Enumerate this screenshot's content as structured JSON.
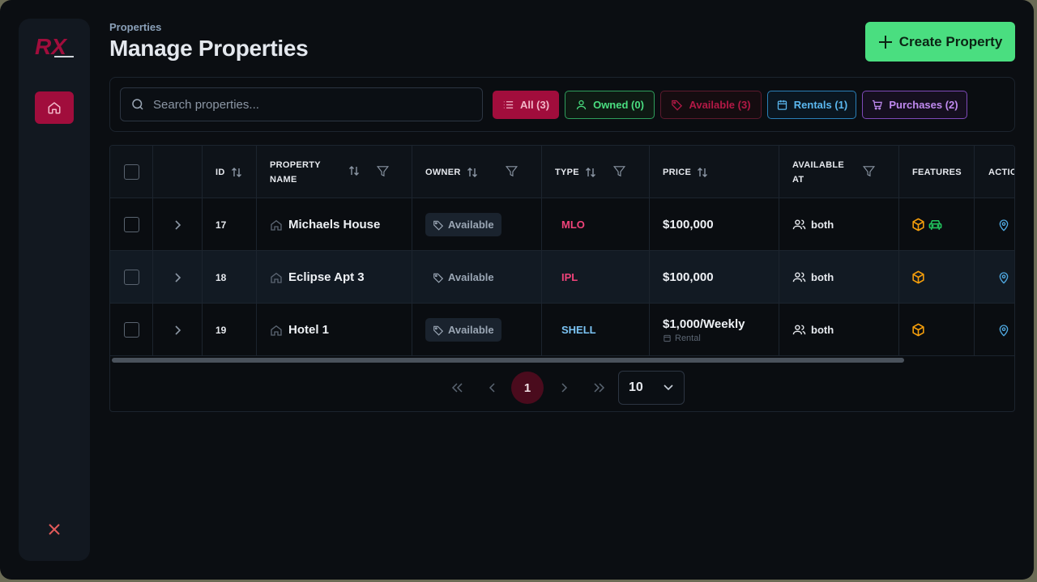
{
  "sidebar": {
    "logo_text": "RX",
    "items": [
      {
        "icon": "home-icon",
        "active": true
      }
    ],
    "close_icon": "close-icon"
  },
  "header": {
    "breadcrumb": "Properties",
    "title": "Manage Properties",
    "create_label": "Create Property"
  },
  "search": {
    "placeholder": "Search properties..."
  },
  "filters": {
    "all": "All (3)",
    "owned": "Owned (0)",
    "available": "Available (3)",
    "rentals": "Rentals (1)",
    "purchases": "Purchases (2)"
  },
  "table": {
    "columns": {
      "id": "ID",
      "property_name_1": "PROPERTY",
      "property_name_2": "NAME",
      "owner": "OWNER",
      "type": "TYPE",
      "price": "PRICE",
      "available_1": "AVAILABLE",
      "available_2": "AT",
      "features": "FEATURES",
      "actions": "ACTIONS"
    },
    "rows": [
      {
        "id": "17",
        "name": "Michaels House",
        "owner": "Available",
        "type": "MLO",
        "type_color": "#f0437a",
        "price": "$100,000",
        "price_sub": "",
        "available_at": "both",
        "features": [
          "box-icon",
          "car-icon"
        ]
      },
      {
        "id": "18",
        "name": "Eclipse Apt 3",
        "owner": "Available",
        "type": "IPL",
        "type_color": "#f0437a",
        "price": "$100,000",
        "price_sub": "",
        "available_at": "both",
        "features": [
          "box-icon"
        ]
      },
      {
        "id": "19",
        "name": "Hotel 1",
        "owner": "Available",
        "type": "SHELL",
        "type_color": "#7cc4f5",
        "price": "$1,000/Weekly",
        "price_sub": "Rental",
        "available_at": "both",
        "features": [
          "box-icon"
        ]
      }
    ]
  },
  "pagination": {
    "current_page": "1",
    "page_size": "10"
  },
  "colors": {
    "accent": "#a10d3c",
    "create": "#4ade80",
    "box": "#f59e0b",
    "car": "#22c55e",
    "pin": "#4fa8e0"
  }
}
